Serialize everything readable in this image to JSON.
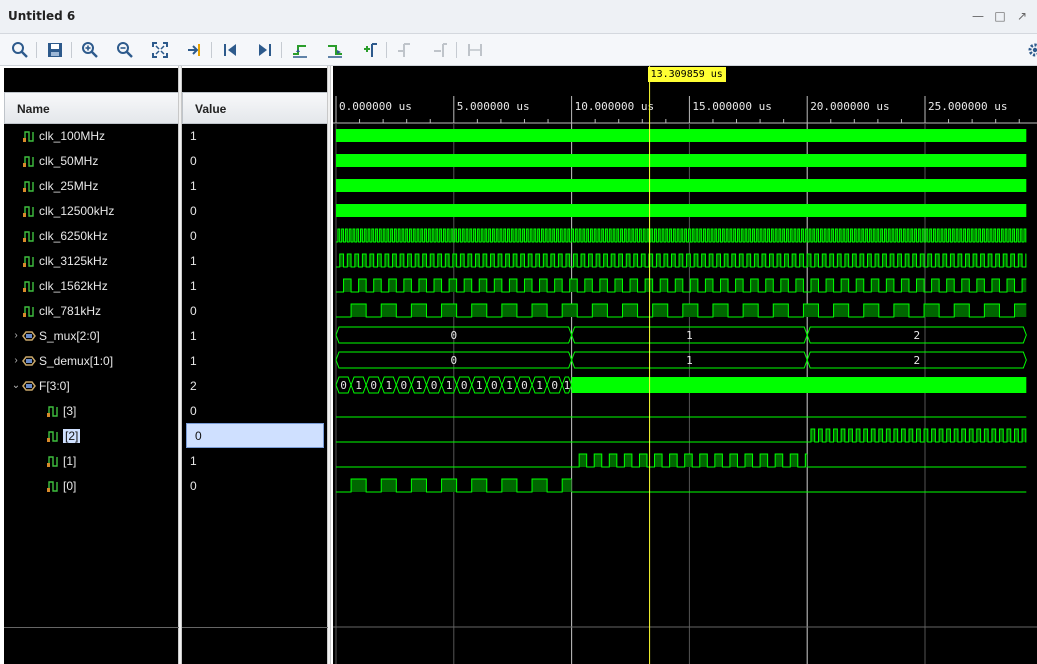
{
  "window": {
    "title": "Untitled 6"
  },
  "toolbar": {
    "icons": [
      "search-icon",
      "save-icon",
      "zoom-in-icon",
      "zoom-out-icon",
      "zoom-fit-icon",
      "go-to-cursor-icon",
      "go-to-time-zero-icon",
      "go-to-last-time-icon",
      "previous-transition-icon",
      "next-transition-icon",
      "add-marker-icon",
      "previous-marker-icon",
      "next-marker-icon",
      "swap-cursors-icon",
      "settings-icon"
    ]
  },
  "columns": {
    "name": "Name",
    "value": "Value"
  },
  "cursor": {
    "label": "13.309859 us",
    "time_us": 13.309859
  },
  "timeline": {
    "start_us": 0,
    "end_us": 29.3,
    "ticks": [
      "0.000000 us",
      "5.000000 us",
      "10.000000 us",
      "15.000000 us",
      "20.000000 us",
      "25.000000 us"
    ],
    "tick_values_us": [
      0,
      5,
      10,
      15,
      20,
      25
    ]
  },
  "signals": [
    {
      "name": "clk_100MHz",
      "value": "1",
      "kind": "clk",
      "level": 0,
      "period_us": 0.01
    },
    {
      "name": "clk_50MHz",
      "value": "0",
      "kind": "clk",
      "level": 0,
      "period_us": 0.02
    },
    {
      "name": "clk_25MHz",
      "value": "1",
      "kind": "clk",
      "level": 0,
      "period_us": 0.04
    },
    {
      "name": "clk_12500kHz",
      "value": "0",
      "kind": "clk",
      "level": 0,
      "period_us": 0.08
    },
    {
      "name": "clk_6250kHz",
      "value": "0",
      "kind": "clk",
      "level": 0,
      "period_us": 0.16
    },
    {
      "name": "clk_3125kHz",
      "value": "1",
      "kind": "clk",
      "level": 0,
      "period_us": 0.32
    },
    {
      "name": "clk_1562kHz",
      "value": "1",
      "kind": "clk",
      "level": 0,
      "period_us": 0.64
    },
    {
      "name": "clk_781kHz",
      "value": "0",
      "kind": "clk",
      "level": 0,
      "period_us": 1.28
    },
    {
      "name": "S_mux[2:0]",
      "value": "1",
      "kind": "bus",
      "level": 0,
      "expand": "collapsed",
      "segments": [
        {
          "from": 0,
          "to": 10,
          "label": "0"
        },
        {
          "from": 10,
          "to": 20,
          "label": "1"
        },
        {
          "from": 20,
          "to": 29.3,
          "label": "2"
        }
      ]
    },
    {
      "name": "S_demux[1:0]",
      "value": "1",
      "kind": "bus",
      "level": 0,
      "expand": "collapsed",
      "segments": [
        {
          "from": 0,
          "to": 10,
          "label": "0"
        },
        {
          "from": 10,
          "to": 20,
          "label": "1"
        },
        {
          "from": 20,
          "to": 29.3,
          "label": "2"
        }
      ]
    },
    {
      "name": "F[3:0]",
      "value": "2",
      "kind": "busF",
      "level": 0,
      "expand": "expanded",
      "dense_from": 10,
      "alt_labels": [
        "0",
        "1",
        "0",
        "1",
        "0",
        "1",
        "0",
        "1",
        "0",
        "1",
        "0",
        "1",
        "0",
        "1",
        "0",
        "1",
        "0",
        "1",
        "0",
        "1"
      ]
    },
    {
      "name": "[3]",
      "value": "0",
      "kind": "flat0",
      "level": 1
    },
    {
      "name": "[2]",
      "value": "0",
      "kind": "clkwin",
      "level": 1,
      "selected": true,
      "from_us": 20,
      "to_us": 29.3,
      "period_us": 0.32
    },
    {
      "name": "[1]",
      "value": "1",
      "kind": "clkwin",
      "level": 1,
      "from_us": 10,
      "to_us": 20,
      "period_us": 0.64
    },
    {
      "name": "[0]",
      "value": "0",
      "kind": "clkwin",
      "level": 1,
      "from_us": 0,
      "to_us": 10,
      "period_us": 1.28
    }
  ],
  "colors": {
    "wave": "#00ff00",
    "waveFill": "#006600",
    "grid": "#555555",
    "cursor": "#ffff33",
    "marker": "#bbbbbb"
  }
}
